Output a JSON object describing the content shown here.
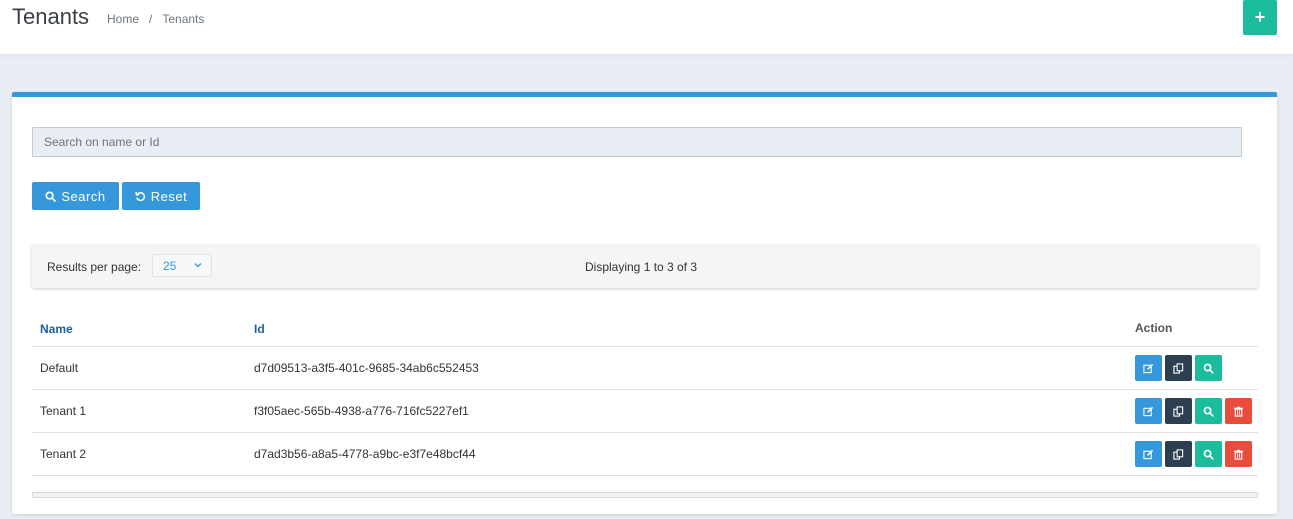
{
  "header": {
    "title": "Tenants",
    "breadcrumb": {
      "home": "Home",
      "separator": "/",
      "current": "Tenants"
    },
    "add_label": "+"
  },
  "search": {
    "placeholder": "Search on name or Id",
    "value": "",
    "search_label": "Search",
    "reset_label": "Reset"
  },
  "pagination": {
    "rpp_label": "Results per page:",
    "rpp_value": "25",
    "displaying": "Displaying 1 to 3 of 3"
  },
  "table": {
    "columns": {
      "name": "Name",
      "id": "Id",
      "action": "Action"
    },
    "rows": [
      {
        "name": "Default",
        "id": "d7d09513-a3f5-401c-9685-34ab6c552453"
      },
      {
        "name": "Tenant 1",
        "id": "f3f05aec-565b-4938-a776-716fc5227ef1"
      },
      {
        "name": "Tenant 2",
        "id": "d7ad3b56-a8a5-4778-a9bc-e3f7e48bcf44"
      }
    ]
  },
  "colors": {
    "accent": "#3498db",
    "success": "#1abc9c",
    "dark": "#2c3e50",
    "danger": "#e74c3c"
  },
  "icons": {
    "add": "plus-icon",
    "search": "search-icon",
    "reset": "undo-icon",
    "edit": "edit-icon",
    "copy": "copy-icon",
    "view": "search-icon",
    "delete": "trash-icon"
  }
}
